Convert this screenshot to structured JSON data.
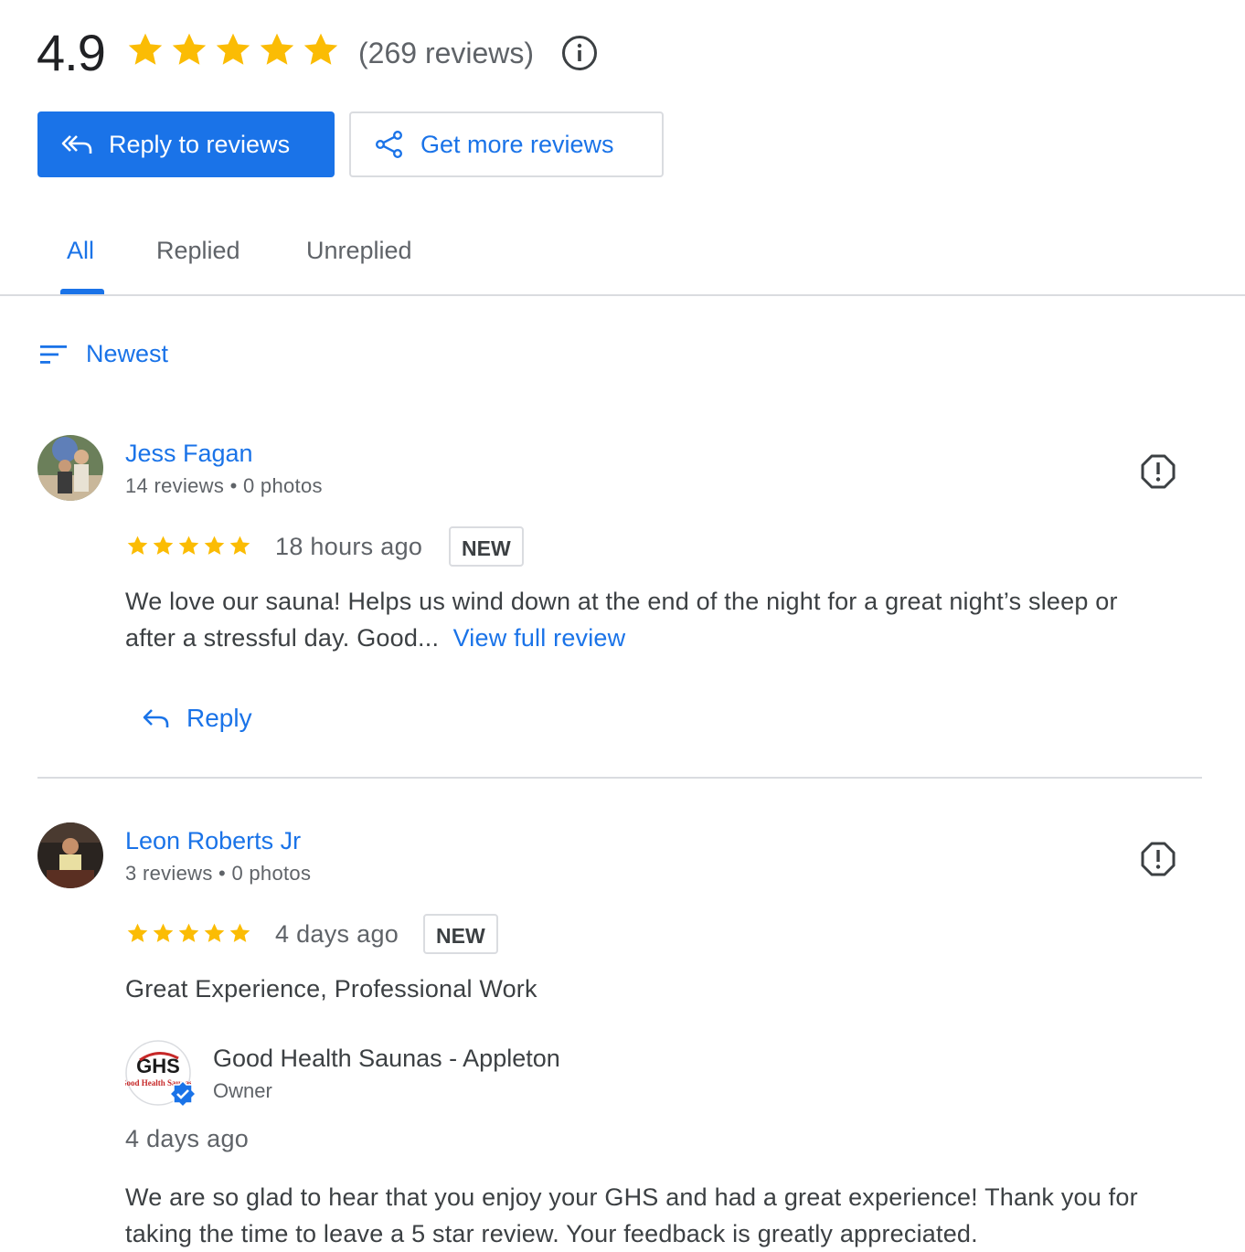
{
  "summary": {
    "rating": "4.9",
    "stars": 5,
    "review_count": "(269 reviews)",
    "star_color": "#fbbc04"
  },
  "actions": {
    "reply_to_reviews": "Reply to reviews",
    "get_more_reviews": "Get more reviews"
  },
  "tabs": [
    {
      "label": "All",
      "active": true
    },
    {
      "label": "Replied",
      "active": false
    },
    {
      "label": "Unreplied",
      "active": false
    }
  ],
  "sort": {
    "label": "Newest",
    "icon": "sort-icon"
  },
  "reviews": [
    {
      "name": "Jess Fagan",
      "meta": "14 reviews • 0 photos",
      "rating": 5,
      "time": "18 hours ago",
      "badge": "NEW",
      "text_line1": "We love our sauna! Helps us wind down at the end of the night for a great night’s sleep or",
      "text_line2": "after a stressful day. Good...",
      "view_full": "View full review",
      "reply_label": "Reply"
    },
    {
      "name": "Leon Roberts Jr",
      "meta": "3 reviews • 0 photos",
      "rating": 5,
      "time": "4 days ago",
      "badge": "NEW",
      "text": "Great Experience, Professional Work",
      "owner_reply": {
        "name": "Good Health Saunas - Appleton",
        "role": "Owner",
        "logo_text": "GHS",
        "logo_sub": "Good Health Saunas",
        "time": "4 days ago",
        "text_line1": "We are so glad to hear that you enjoy your GHS and had a great experience! Thank you for",
        "text_line2": "taking the time to leave a 5 star review. Your feedback is greatly appreciated."
      }
    }
  ],
  "colors": {
    "accent": "#1a73e8",
    "divider": "#dadce0",
    "text": "#3c4043",
    "muted": "#5f6368"
  }
}
